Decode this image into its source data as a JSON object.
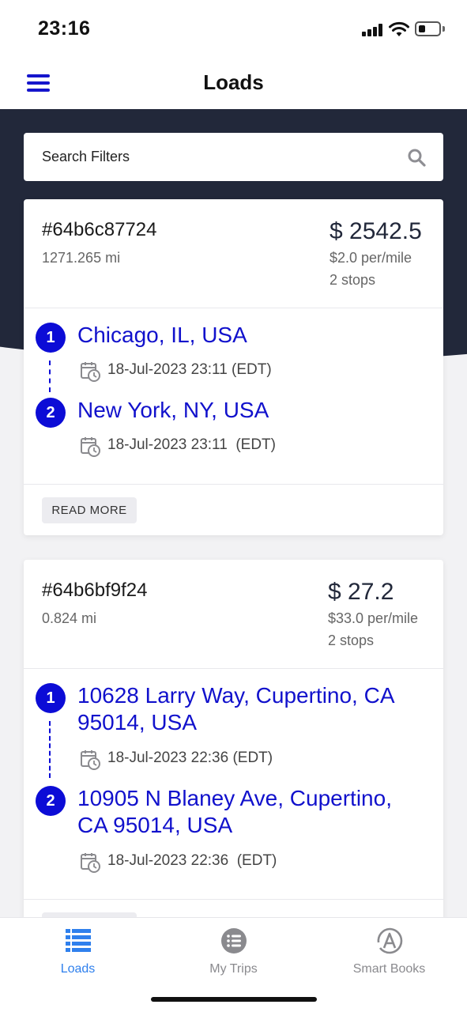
{
  "status_bar": {
    "time": "23:16"
  },
  "nav": {
    "title": "Loads"
  },
  "search": {
    "placeholder": "Search Filters"
  },
  "loads": [
    {
      "id": "#64b6c87724",
      "distance": "1271.265 mi",
      "price": "$ 2542.5",
      "per_mile": "$2.0 per/mile",
      "stops_count": "2 stops",
      "stops": [
        {
          "number": "1",
          "address": "Chicago, IL, USA",
          "time": "18-Jul-2023 23:11 (EDT)"
        },
        {
          "number": "2",
          "address": "New York, NY, USA",
          "time": "18-Jul-2023 23:11  (EDT)"
        }
      ],
      "read_more": "READ MORE"
    },
    {
      "id": "#64b6bf9f24",
      "distance": "0.824 mi",
      "price": "$ 27.2",
      "per_mile": "$33.0 per/mile",
      "stops_count": "2 stops",
      "stops": [
        {
          "number": "1",
          "address": "10628 Larry Way, Cupertino, CA 95014, USA",
          "time": "18-Jul-2023 22:36 (EDT)"
        },
        {
          "number": "2",
          "address": "10905 N Blaney Ave, Cupertino, CA 95014, USA",
          "time": "18-Jul-2023 22:36  (EDT)"
        }
      ]
    }
  ],
  "tabs": [
    {
      "label": "Loads",
      "icon": "list-icon",
      "active": true
    },
    {
      "label": "My Trips",
      "icon": "trips-list-icon",
      "active": false
    },
    {
      "label": "Smart Books",
      "icon": "smart-books-icon",
      "active": false
    }
  ],
  "colors": {
    "accent": "#0c0cd6",
    "header_dark": "#22283a",
    "tab_active": "#2f80ed"
  }
}
